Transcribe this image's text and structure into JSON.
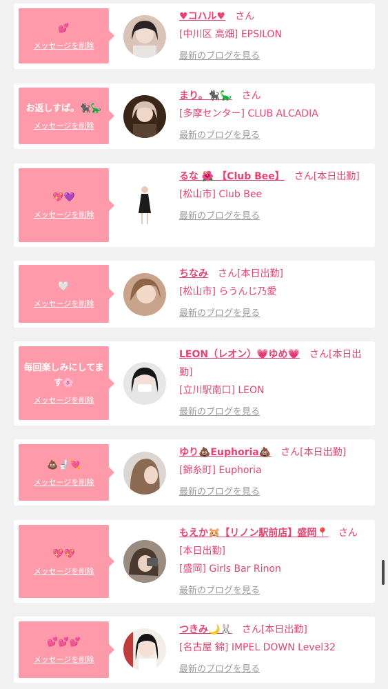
{
  "threads": [
    {
      "message": "💕",
      "delete_label": "メッセージを削除",
      "name": "♥コハル♥",
      "honorific": "さん",
      "shop": "[中川区 高畑] EPSILON",
      "blog_link": "最新のブログを見る"
    },
    {
      "message": "お返しすば。🐈‍⬛🦕",
      "delete_label": "メッセージを削除",
      "name": "まり。🐈‍⬛🦕",
      "honorific": "さん",
      "shop": "[多摩センター] CLUB ALCADIA",
      "blog_link": "最新のブログを見る"
    },
    {
      "message": "💖💜",
      "delete_label": "メッセージを削除",
      "name": "るな 🌺 【Club Bee】",
      "honorific": "さん[本日出勤]",
      "shop": "[松山市] Club Bee",
      "blog_link": "最新のブログを見る"
    },
    {
      "message": "🤍",
      "delete_label": "メッセージを削除",
      "name": "ちなみ",
      "honorific": "さん[本日出勤]",
      "shop": "[松山市] らうんじ乃愛",
      "blog_link": "最新のブログを見る"
    },
    {
      "message": "毎回楽しみにしてます🌸",
      "delete_label": "メッセージを削除",
      "name": "LEON（レオン）💗ゆめ💗",
      "honorific": "さん[本日出勤]",
      "shop": "[立川駅南口] LEON",
      "blog_link": "最新のブログを見る"
    },
    {
      "message": "💩🚽💘",
      "delete_label": "メッセージを削除",
      "name": "ゆり💩Euphoria💩",
      "honorific": "さん[本日出勤]",
      "shop": "[錦糸町] Euphoria",
      "blog_link": "最新のブログを見る"
    },
    {
      "message": "💖💖",
      "delete_label": "メッセージを削除",
      "name": "もえか🐹【リノン駅前店】盛岡📍",
      "honorific": "さん[本日出勤]",
      "shop": "[盛岡] Girls Bar Rinon",
      "blog_link": "最新のブログを見る"
    },
    {
      "message": "💕💕💕",
      "delete_label": "メッセージを削除",
      "name": "つきみ🌙🐰",
      "honorific": "さん[本日出勤]",
      "shop": "[名古屋 錦] IMPEL DOWN Level32",
      "blog_link": "最新のブログを見る"
    }
  ]
}
